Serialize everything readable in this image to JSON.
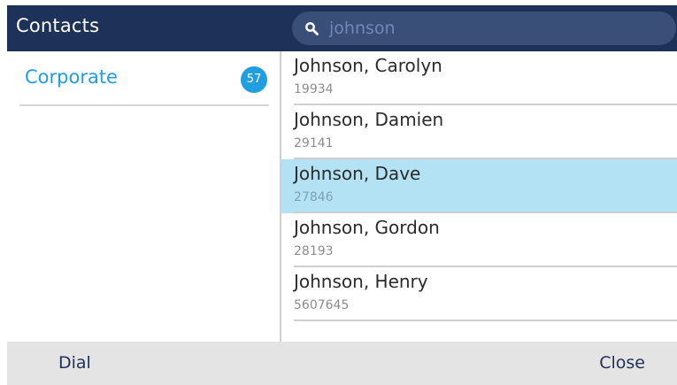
{
  "header": {
    "title": "Contacts",
    "search_value": "johnson"
  },
  "sidebar": {
    "items": [
      {
        "label": "Corporate",
        "count": "57"
      }
    ]
  },
  "contacts": [
    {
      "name": "Johnson, Carolyn",
      "number": "19934"
    },
    {
      "name": "Johnson, Damien",
      "number": "29141"
    },
    {
      "name": "Johnson, Dave",
      "number": "27846"
    },
    {
      "name": "Johnson, Gordon",
      "number": "28193"
    },
    {
      "name": "Johnson, Henry",
      "number": "5607645"
    }
  ],
  "softkeys": {
    "left": "Dial",
    "right": "Close"
  },
  "colors": {
    "header_bg": "#1e3158",
    "accent": "#1f9ee0",
    "selected_row": "#b3e2f5",
    "softkey_bar": "#e4e4e4"
  },
  "icons": {
    "search": "search-icon"
  }
}
